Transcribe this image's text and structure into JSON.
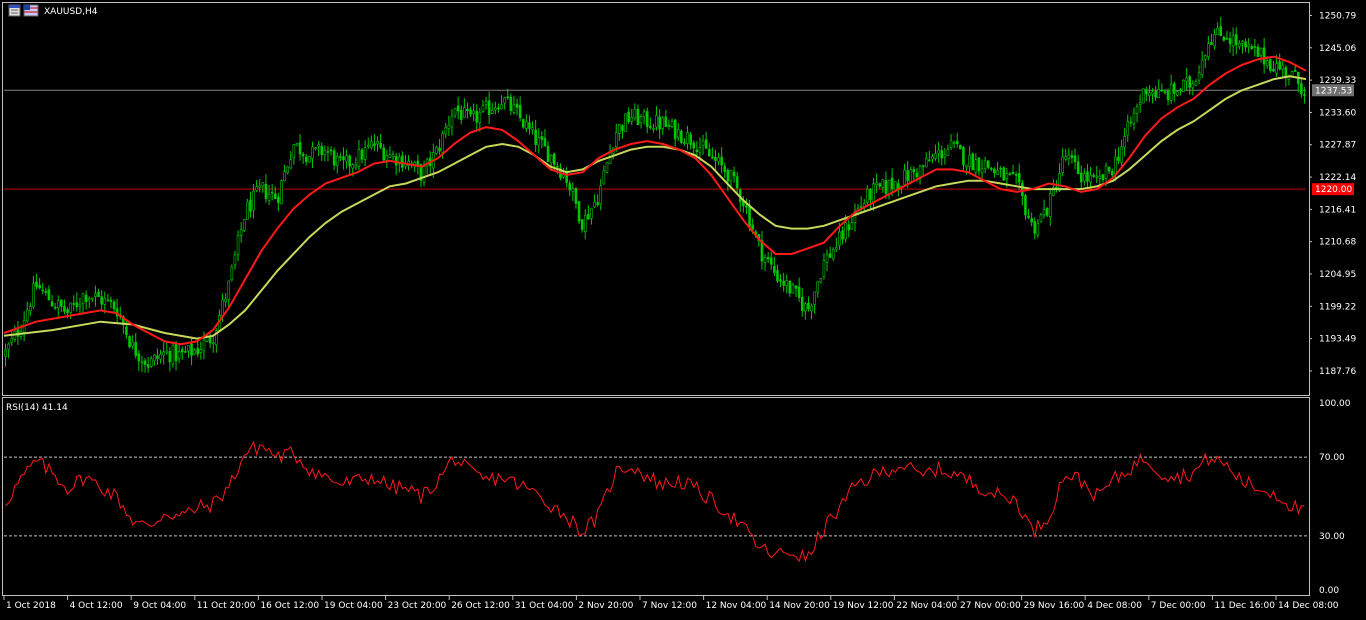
{
  "window": {
    "symbol_label": "XAUUSD,H4"
  },
  "chart_data": [
    {
      "type": "candlestick",
      "title": "XAUUSD,H4",
      "ylim": [
        1183.5,
        1253.0
      ],
      "grid": false,
      "colors": {
        "background": "#000000",
        "candles": "#00c800",
        "ma_fast": "#ff1a1a",
        "ma_slow": "#c8d85a",
        "price_line": "#808080",
        "level_line": "#c00000"
      },
      "y_ticks": [
        "1250.79",
        "1245.06",
        "1239.33",
        "1233.60",
        "1227.87",
        "1222.14",
        "1216.41",
        "1210.68",
        "1204.95",
        "1199.22",
        "1193.49",
        "1187.76"
      ],
      "x_ticks": [
        "1 Oct 2018",
        "4 Oct 12:00",
        "9 Oct 04:00",
        "11 Oct 20:00",
        "16 Oct 12:00",
        "19 Oct 04:00",
        "23 Oct 20:00",
        "26 Oct 12:00",
        "31 Oct 04:00",
        "2 Nov 20:00",
        "7 Nov 12:00",
        "12 Nov 04:00",
        "14 Nov 20:00",
        "19 Nov 12:00",
        "22 Nov 04:00",
        "27 Nov 00:00",
        "29 Nov 16:00",
        "4 Dec 08:00",
        "7 Dec 00:00",
        "11 Dec 16:00",
        "14 Dec 08:00"
      ],
      "current_price": "1237.53",
      "level_price": "1220.00",
      "close_path": [
        [
          0,
          1190.5
        ],
        [
          1,
          1195.5
        ],
        [
          2,
          1203.0
        ],
        [
          3,
          1200.0
        ],
        [
          4,
          1198.0
        ],
        [
          5,
          1201.5
        ],
        [
          6,
          1200.5
        ],
        [
          7,
          1199.0
        ],
        [
          8,
          1192.0
        ],
        [
          9,
          1189.0
        ],
        [
          10,
          1191.0
        ],
        [
          11,
          1190.5
        ],
        [
          12,
          1191.5
        ],
        [
          13,
          1194.0
        ],
        [
          14,
          1203.0
        ],
        [
          15,
          1216.0
        ],
        [
          16,
          1220.0
        ],
        [
          17,
          1218.5
        ],
        [
          18,
          1228.0
        ],
        [
          19,
          1226.0
        ],
        [
          20,
          1227.0
        ],
        [
          21,
          1224.0
        ],
        [
          22,
          1225.5
        ],
        [
          23,
          1228.0
        ],
        [
          24,
          1226.0
        ],
        [
          25,
          1225.0
        ],
        [
          26,
          1222.5
        ],
        [
          27,
          1227.0
        ],
        [
          28,
          1234.5
        ],
        [
          29,
          1232.0
        ],
        [
          30,
          1234.0
        ],
        [
          31,
          1236.0
        ],
        [
          32,
          1233.0
        ],
        [
          33,
          1229.0
        ],
        [
          34,
          1226.0
        ],
        [
          35,
          1222.0
        ],
        [
          36,
          1214.0
        ],
        [
          37,
          1219.0
        ],
        [
          38,
          1230.0
        ],
        [
          39,
          1233.0
        ],
        [
          40,
          1232.0
        ],
        [
          41,
          1231.5
        ],
        [
          42,
          1230.0
        ],
        [
          43,
          1228.5
        ],
        [
          44,
          1225.5
        ],
        [
          45,
          1223.0
        ],
        [
          46,
          1218.0
        ],
        [
          47,
          1209.5
        ],
        [
          48,
          1205.0
        ],
        [
          49,
          1202.0
        ],
        [
          50,
          1198.5
        ],
        [
          51,
          1207.0
        ],
        [
          52,
          1211.0
        ],
        [
          53,
          1216.0
        ],
        [
          54,
          1219.5
        ],
        [
          55,
          1220.5
        ],
        [
          56,
          1222.0
        ],
        [
          57,
          1223.5
        ],
        [
          58,
          1226.0
        ],
        [
          59,
          1227.5
        ],
        [
          60,
          1225.0
        ],
        [
          61,
          1224.5
        ],
        [
          62,
          1222.5
        ],
        [
          63,
          1221.0
        ],
        [
          64,
          1213.0
        ],
        [
          65,
          1217.0
        ],
        [
          66,
          1226.0
        ],
        [
          67,
          1222.5
        ],
        [
          68,
          1221.0
        ],
        [
          69,
          1224.0
        ],
        [
          70,
          1231.0
        ],
        [
          71,
          1238.0
        ],
        [
          72,
          1236.5
        ],
        [
          73,
          1237.5
        ],
        [
          74,
          1239.0
        ],
        [
          75,
          1247.0
        ],
        [
          76,
          1247.5
        ],
        [
          77,
          1245.0
        ],
        [
          78,
          1244.0
        ],
        [
          79,
          1242.0
        ],
        [
          80,
          1240.5
        ],
        [
          81,
          1237.5
        ]
      ],
      "ma_fast_path": [
        [
          0,
          1194.5
        ],
        [
          2,
          1196.5
        ],
        [
          4,
          1197.5
        ],
        [
          6,
          1198.5
        ],
        [
          7,
          1198.0
        ],
        [
          8,
          1196.0
        ],
        [
          9,
          1194.5
        ],
        [
          10,
          1193.0
        ],
        [
          11,
          1192.5
        ],
        [
          12,
          1193.0
        ],
        [
          13,
          1195.0
        ],
        [
          14,
          1199.0
        ],
        [
          15,
          1204.0
        ],
        [
          16,
          1209.0
        ],
        [
          17,
          1213.0
        ],
        [
          18,
          1216.5
        ],
        [
          19,
          1219.0
        ],
        [
          20,
          1221.0
        ],
        [
          21,
          1222.0
        ],
        [
          22,
          1223.0
        ],
        [
          23,
          1224.5
        ],
        [
          24,
          1225.0
        ],
        [
          25,
          1224.5
        ],
        [
          26,
          1224.0
        ],
        [
          27,
          1225.5
        ],
        [
          28,
          1228.0
        ],
        [
          29,
          1230.0
        ],
        [
          30,
          1231.0
        ],
        [
          31,
          1230.5
        ],
        [
          32,
          1228.5
        ],
        [
          33,
          1226.0
        ],
        [
          34,
          1223.5
        ],
        [
          35,
          1222.5
        ],
        [
          36,
          1223.0
        ],
        [
          37,
          1225.5
        ],
        [
          38,
          1227.0
        ],
        [
          39,
          1228.0
        ],
        [
          40,
          1228.5
        ],
        [
          41,
          1228.0
        ],
        [
          42,
          1227.0
        ],
        [
          43,
          1225.5
        ],
        [
          44,
          1222.5
        ],
        [
          45,
          1218.5
        ],
        [
          46,
          1214.5
        ],
        [
          47,
          1211.0
        ],
        [
          48,
          1208.5
        ],
        [
          49,
          1208.5
        ],
        [
          50,
          1209.5
        ],
        [
          51,
          1210.5
        ],
        [
          52,
          1213.5
        ],
        [
          53,
          1216.0
        ],
        [
          54,
          1217.5
        ],
        [
          55,
          1219.0
        ],
        [
          56,
          1220.5
        ],
        [
          57,
          1222.0
        ],
        [
          58,
          1223.5
        ],
        [
          59,
          1223.5
        ],
        [
          60,
          1223.0
        ],
        [
          61,
          1221.5
        ],
        [
          62,
          1220.0
        ],
        [
          63,
          1219.5
        ],
        [
          64,
          1220.0
        ],
        [
          65,
          1221.0
        ],
        [
          66,
          1220.5
        ],
        [
          67,
          1219.5
        ],
        [
          68,
          1220.0
        ],
        [
          69,
          1222.0
        ],
        [
          70,
          1225.5
        ],
        [
          71,
          1229.5
        ],
        [
          72,
          1232.5
        ],
        [
          73,
          1234.5
        ],
        [
          74,
          1236.0
        ],
        [
          75,
          1238.5
        ],
        [
          76,
          1240.5
        ],
        [
          77,
          1242.0
        ],
        [
          78,
          1243.0
        ],
        [
          79,
          1243.5
        ],
        [
          80,
          1242.5
        ],
        [
          81,
          1241.0
        ]
      ],
      "ma_slow_path": [
        [
          0,
          1194.0
        ],
        [
          3,
          1195.0
        ],
        [
          6,
          1196.5
        ],
        [
          8,
          1196.0
        ],
        [
          10,
          1194.5
        ],
        [
          12,
          1193.5
        ],
        [
          13,
          1194.0
        ],
        [
          14,
          1196.0
        ],
        [
          15,
          1198.5
        ],
        [
          16,
          1202.0
        ],
        [
          17,
          1205.5
        ],
        [
          18,
          1208.5
        ],
        [
          19,
          1211.5
        ],
        [
          20,
          1214.0
        ],
        [
          21,
          1216.0
        ],
        [
          22,
          1217.5
        ],
        [
          23,
          1219.0
        ],
        [
          24,
          1220.5
        ],
        [
          25,
          1221.0
        ],
        [
          26,
          1222.0
        ],
        [
          27,
          1223.0
        ],
        [
          28,
          1224.5
        ],
        [
          29,
          1226.0
        ],
        [
          30,
          1227.5
        ],
        [
          31,
          1228.0
        ],
        [
          32,
          1227.5
        ],
        [
          33,
          1226.0
        ],
        [
          34,
          1224.0
        ],
        [
          35,
          1223.0
        ],
        [
          36,
          1223.5
        ],
        [
          37,
          1225.0
        ],
        [
          38,
          1226.0
        ],
        [
          39,
          1227.0
        ],
        [
          40,
          1227.5
        ],
        [
          41,
          1227.5
        ],
        [
          42,
          1227.0
        ],
        [
          43,
          1226.0
        ],
        [
          44,
          1224.0
        ],
        [
          45,
          1221.0
        ],
        [
          46,
          1218.0
        ],
        [
          47,
          1215.5
        ],
        [
          48,
          1213.5
        ],
        [
          49,
          1213.0
        ],
        [
          50,
          1213.0
        ],
        [
          51,
          1213.5
        ],
        [
          52,
          1214.5
        ],
        [
          53,
          1215.5
        ],
        [
          54,
          1216.5
        ],
        [
          55,
          1217.5
        ],
        [
          56,
          1218.5
        ],
        [
          57,
          1219.5
        ],
        [
          58,
          1220.5
        ],
        [
          59,
          1221.0
        ],
        [
          60,
          1221.5
        ],
        [
          61,
          1221.5
        ],
        [
          62,
          1221.0
        ],
        [
          63,
          1220.5
        ],
        [
          64,
          1220.0
        ],
        [
          65,
          1220.0
        ],
        [
          66,
          1220.0
        ],
        [
          67,
          1220.0
        ],
        [
          68,
          1220.5
        ],
        [
          69,
          1221.5
        ],
        [
          70,
          1223.5
        ],
        [
          71,
          1226.0
        ],
        [
          72,
          1228.5
        ],
        [
          73,
          1230.5
        ],
        [
          74,
          1232.0
        ],
        [
          75,
          1234.0
        ],
        [
          76,
          1236.0
        ],
        [
          77,
          1237.5
        ],
        [
          78,
          1238.5
        ],
        [
          79,
          1239.5
        ],
        [
          80,
          1240.0
        ],
        [
          81,
          1239.5
        ]
      ],
      "x_span": [
        0,
        81
      ]
    },
    {
      "type": "line",
      "title": "RSI(14) 41.14",
      "ylim": [
        0,
        100
      ],
      "y_ticks": [
        "100.00",
        "70.00",
        "30.00",
        "0.00"
      ],
      "levels": [
        70,
        30
      ],
      "colors": {
        "line": "#ff1a1a",
        "levels": "#c0c0c0"
      },
      "values_path": [
        [
          0,
          46
        ],
        [
          1,
          58
        ],
        [
          2,
          68
        ],
        [
          3,
          62
        ],
        [
          4,
          54
        ],
        [
          5,
          60
        ],
        [
          6,
          55
        ],
        [
          7,
          50
        ],
        [
          8,
          38
        ],
        [
          9,
          34
        ],
        [
          10,
          42
        ],
        [
          11,
          40
        ],
        [
          12,
          44
        ],
        [
          13,
          46
        ],
        [
          14,
          55
        ],
        [
          15,
          72
        ],
        [
          16,
          76
        ],
        [
          17,
          70
        ],
        [
          18,
          72
        ],
        [
          19,
          64
        ],
        [
          20,
          60
        ],
        [
          21,
          56
        ],
        [
          22,
          58
        ],
        [
          23,
          60
        ],
        [
          24,
          55
        ],
        [
          25,
          54
        ],
        [
          26,
          50
        ],
        [
          27,
          58
        ],
        [
          28,
          70
        ],
        [
          29,
          62
        ],
        [
          30,
          58
        ],
        [
          31,
          60
        ],
        [
          32,
          56
        ],
        [
          33,
          52
        ],
        [
          34,
          46
        ],
        [
          35,
          40
        ],
        [
          36,
          32
        ],
        [
          37,
          40
        ],
        [
          38,
          62
        ],
        [
          39,
          66
        ],
        [
          40,
          60
        ],
        [
          41,
          56
        ],
        [
          42,
          58
        ],
        [
          43,
          54
        ],
        [
          44,
          48
        ],
        [
          45,
          42
        ],
        [
          46,
          34
        ],
        [
          47,
          24
        ],
        [
          48,
          20
        ],
        [
          49,
          22
        ],
        [
          50,
          18
        ],
        [
          51,
          34
        ],
        [
          52,
          44
        ],
        [
          53,
          56
        ],
        [
          54,
          60
        ],
        [
          55,
          64
        ],
        [
          56,
          66
        ],
        [
          57,
          60
        ],
        [
          58,
          64
        ],
        [
          59,
          62
        ],
        [
          60,
          58
        ],
        [
          61,
          54
        ],
        [
          62,
          50
        ],
        [
          63,
          48
        ],
        [
          64,
          32
        ],
        [
          65,
          40
        ],
        [
          66,
          62
        ],
        [
          67,
          58
        ],
        [
          68,
          50
        ],
        [
          69,
          58
        ],
        [
          70,
          64
        ],
        [
          71,
          70
        ],
        [
          72,
          62
        ],
        [
          73,
          60
        ],
        [
          74,
          62
        ],
        [
          75,
          70
        ],
        [
          76,
          66
        ],
        [
          77,
          58
        ],
        [
          78,
          54
        ],
        [
          79,
          52
        ],
        [
          80,
          46
        ],
        [
          81,
          41
        ]
      ]
    }
  ]
}
